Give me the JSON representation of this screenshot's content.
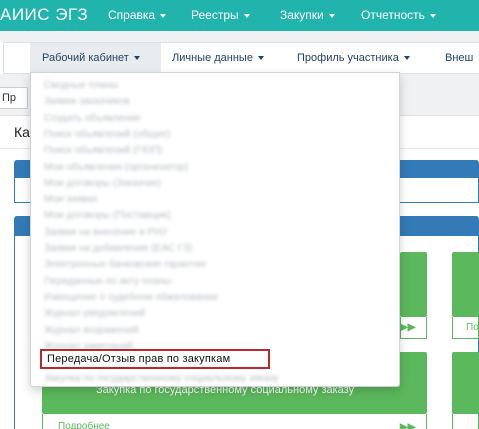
{
  "brand": "АИИС ЭГЗ",
  "topnav": [
    {
      "label": "Справка"
    },
    {
      "label": "Реестры"
    },
    {
      "label": "Закупки"
    },
    {
      "label": "Отчетность"
    }
  ],
  "subnav": [
    {
      "label": "Рабочий кабинет"
    },
    {
      "label": "Личные данные"
    },
    {
      "label": "Профиль участника"
    },
    {
      "label": "Внеш"
    }
  ],
  "page": {
    "button_label": "Пр",
    "panel_title": "Ка",
    "tile_link_label": "Подробнее",
    "tile_right_label": "По",
    "tile_main_text": "Закупка по государственному социальному заказу"
  },
  "dropdown": {
    "items": [
      {
        "label": "Сводные планы"
      },
      {
        "label": "Заявки заказчиков"
      },
      {
        "label": "Создать объявление"
      },
      {
        "label": "Поиск объявлений (общие)"
      },
      {
        "label": "Поиск объявлений (ГЮП)"
      },
      {
        "label": "Мои объявления (организатор)"
      },
      {
        "label": "Мои договоры (Заказчик)"
      },
      {
        "label": "Мои заявки"
      },
      {
        "label": "Мои договоры (Поставщик)"
      },
      {
        "label": "Заявки на внесение в РНУ"
      },
      {
        "label": "Заявки на добавление (ЕАС ГЗ)"
      },
      {
        "label": "Электронные банковские гарантии"
      },
      {
        "label": "Переданные по акту планы"
      },
      {
        "label": "Извещение о судебном обжаловании"
      },
      {
        "label": "Журнал уведомлений"
      },
      {
        "label": "Журнал возражений"
      },
      {
        "label": "Журнал замечаний"
      }
    ],
    "highlighted": "Передача/Отзыв прав по закупкам",
    "after": "Закупка по государственному социальному заказу"
  },
  "colors": {
    "topbar": "#21b4ad",
    "highlight_border": "#c0272d",
    "tile_green": "#5cb85c",
    "panel_blue": "#337ab7"
  }
}
